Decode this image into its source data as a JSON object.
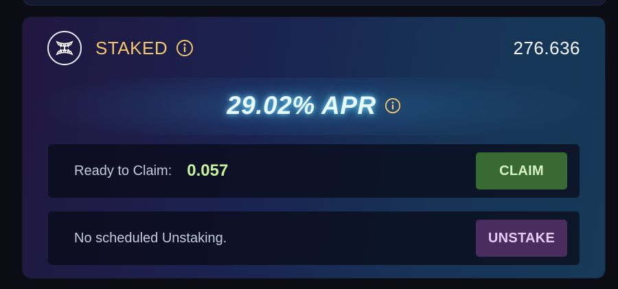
{
  "staking_card": {
    "title": "STAKED",
    "staked_amount": "276.636",
    "apr_text": "29.02% APR",
    "claim": {
      "label": "Ready to Claim:",
      "value": "0.057",
      "button_label": "CLAIM"
    },
    "unstake": {
      "status_text": "No scheduled Unstaking.",
      "button_label": "UNSTAKE"
    }
  },
  "icons": {
    "logo": "fangs-logo-icon",
    "info": "info-icon"
  },
  "colors": {
    "title": "#f2c76d",
    "claim_value": "#c7f29a",
    "claim_button": "#3a6a34",
    "unstake_button": "#4b2c5e",
    "apr_glow": "#78dcff"
  }
}
